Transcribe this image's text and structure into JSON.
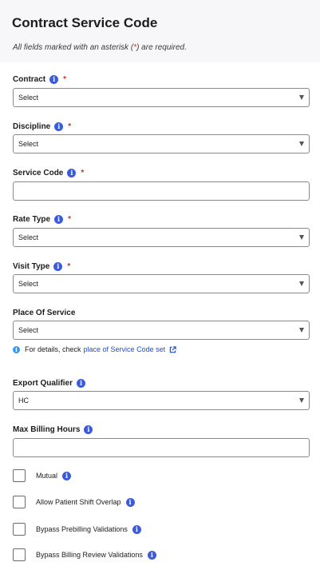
{
  "header": {
    "title": "Contract Service Code",
    "subtitle_prefix": "All fields marked with an asterisk (",
    "subtitle_asterisk": "*",
    "subtitle_suffix": ") are required."
  },
  "fields": {
    "contract": {
      "label": "Contract",
      "value": "Select"
    },
    "discipline": {
      "label": "Discipline",
      "value": "Select"
    },
    "service_code": {
      "label": "Service Code",
      "value": ""
    },
    "rate_type": {
      "label": "Rate Type",
      "value": "Select"
    },
    "visit_type": {
      "label": "Visit Type",
      "value": "Select"
    },
    "place_of_service": {
      "label": "Place Of Service",
      "value": "Select"
    },
    "export_qualifier": {
      "label": "Export Qualifier",
      "value": "HC"
    },
    "max_billing_hours": {
      "label": "Max Billing Hours",
      "value": ""
    }
  },
  "required_marker": "*",
  "info_glyph": "i",
  "hint": {
    "text": "For details, check",
    "link": "place of Service Code set"
  },
  "checkboxes": {
    "mutual": {
      "label": "Mutual",
      "checked": false
    },
    "allow_overlap": {
      "label": "Allow Patient Shift Overlap",
      "checked": false
    },
    "bypass_prebilling": {
      "label": "Bypass Prebilling Validations",
      "checked": false
    },
    "bypass_billing_review": {
      "label": "Bypass Billing Review Validations",
      "checked": false
    }
  },
  "colors": {
    "info_icon": "#3b5bdb",
    "required": "#c0392b",
    "link": "#1c4fd8"
  }
}
